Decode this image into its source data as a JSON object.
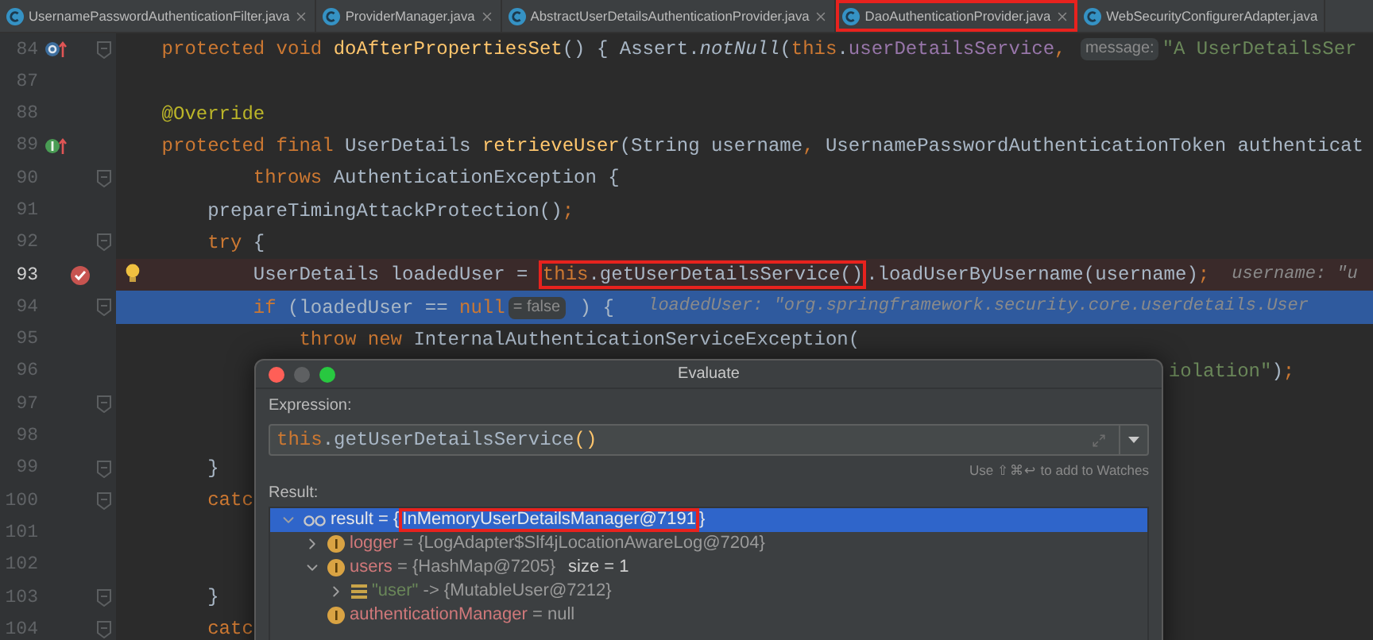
{
  "tabs": [
    {
      "label": "UsernamePasswordAuthenticationFilter.java",
      "boxed": false,
      "closable": true
    },
    {
      "label": "ProviderManager.java",
      "boxed": false,
      "closable": true
    },
    {
      "label": "AbstractUserDetailsAuthenticationProvider.java",
      "boxed": false,
      "closable": true
    },
    {
      "label": "DaoAuthenticationProvider.java",
      "boxed": true,
      "closable": true
    },
    {
      "label": "WebSecurityConfigurerAdapter.java",
      "boxed": false,
      "closable": false
    }
  ],
  "editor": {
    "lines": [
      {
        "number": "84",
        "kind": "override",
        "bulb": false,
        "fold": true,
        "selected": false,
        "segments": [
          {
            "text": "    protected void ",
            "kind": "kw"
          },
          {
            "text": "doAfterPropertiesSet",
            "kind": "method"
          },
          {
            "text": "() { Assert.",
            "kind": "plain"
          },
          {
            "text": "notNull",
            "kind": "static"
          },
          {
            "text": "(",
            "kind": "plain"
          },
          {
            "text": "this",
            "kind": "kw"
          },
          {
            "text": ".",
            "kind": "plain"
          },
          {
            "text": "userDetailsService",
            "kind": "field"
          },
          {
            "text": ", ",
            "kind": "kw"
          },
          {
            "text": "message:",
            "kind": "hint"
          },
          {
            "text": "\"A UserDetailsSer",
            "kind": "str"
          }
        ]
      },
      {
        "number": "87",
        "bulb": false,
        "fold": false,
        "selected": false
      },
      {
        "number": "88",
        "bulb": false,
        "fold": false,
        "selected": false,
        "segments": [
          {
            "text": "    @Override",
            "kind": "ann"
          }
        ]
      },
      {
        "number": "89",
        "kind": "implements",
        "bulb": false,
        "fold": false,
        "selected": false,
        "segments": [
          {
            "text": "    protected final ",
            "kind": "kw"
          },
          {
            "text": "UserDetails ",
            "kind": "plain"
          },
          {
            "text": "retrieveUser",
            "kind": "method"
          },
          {
            "text": "(String username",
            "kind": "plain"
          },
          {
            "text": ", ",
            "kind": "kw"
          },
          {
            "text": "UsernamePasswordAuthenticationToken authenticat",
            "kind": "plain"
          }
        ]
      },
      {
        "number": "90",
        "bulb": false,
        "fold": true,
        "selected": false,
        "segments": [
          {
            "text": "            throws ",
            "kind": "kw"
          },
          {
            "text": "AuthenticationException {",
            "kind": "plain"
          }
        ]
      },
      {
        "number": "91",
        "bulb": false,
        "fold": false,
        "selected": false,
        "segments": [
          {
            "text": "        prepareTimingAttackProtection()",
            "kind": "plain"
          },
          {
            "text": ";",
            "kind": "kw"
          }
        ]
      },
      {
        "number": "92",
        "bulb": false,
        "fold": true,
        "selected": false,
        "segments": [
          {
            "text": "        try ",
            "kind": "kw"
          },
          {
            "text": "{",
            "kind": "plain"
          }
        ]
      },
      {
        "number": "93",
        "kind": "breakpoint",
        "bulb": true,
        "fold": false,
        "selected": false,
        "segments": [
          {
            "text": "            UserDetails loadedUser = ",
            "kind": "plain"
          },
          {
            "text": "this",
            "kind": "kw",
            "boxed": true
          },
          {
            "text": ".getUserDetailsService()",
            "kind": "plain",
            "boxed": true
          },
          {
            "text": ".loadUserByUsername(username)",
            "kind": "plain"
          },
          {
            "text": ";",
            "kind": "kw"
          },
          {
            "text": "username: \"u",
            "kind": "debug"
          }
        ]
      },
      {
        "number": "94",
        "bulb": false,
        "fold": true,
        "selected": true,
        "segments": [
          {
            "text": "            if ",
            "kind": "kw"
          },
          {
            "text": "(loadedUser == ",
            "kind": "plain"
          },
          {
            "text": "null",
            "kind": "kw"
          },
          {
            "text": "= false",
            "kind": "hint"
          },
          {
            "text": " ) { ",
            "kind": "plain"
          },
          {
            "text": "loadedUser: \"org.springframework.security.core.userdetails.User",
            "kind": "debug"
          }
        ]
      },
      {
        "number": "95",
        "bulb": false,
        "fold": false,
        "selected": false,
        "segments": [
          {
            "text": "                throw new ",
            "kind": "kw"
          },
          {
            "text": "InternalAuthenticationServiceException(",
            "kind": "plain"
          }
        ]
      },
      {
        "number": "96",
        "bulb": false,
        "fold": false,
        "selected": false,
        "segments": [
          {
            "text": "                                                                                            iolation\"",
            "kind": "str"
          },
          {
            "text": ")",
            "kind": "plain"
          },
          {
            "text": ";",
            "kind": "kw"
          }
        ]
      },
      {
        "number": "97",
        "bulb": false,
        "fold": true,
        "selected": false
      },
      {
        "number": "98",
        "bulb": false,
        "fold": false,
        "selected": false
      },
      {
        "number": "99",
        "bulb": false,
        "fold": true,
        "selected": false,
        "segments": [
          {
            "text": "        }",
            "kind": "plain"
          }
        ]
      },
      {
        "number": "100",
        "bulb": false,
        "fold": true,
        "selected": false,
        "segments": [
          {
            "text": "        catc",
            "kind": "kw"
          }
        ]
      },
      {
        "number": "101",
        "bulb": false,
        "fold": false,
        "selected": false
      },
      {
        "number": "102",
        "bulb": false,
        "fold": false,
        "selected": false
      },
      {
        "number": "103",
        "bulb": false,
        "fold": true,
        "selected": false,
        "segments": [
          {
            "text": "        }",
            "kind": "plain"
          }
        ]
      },
      {
        "number": "104",
        "bulb": false,
        "fold": true,
        "selected": false,
        "segments": [
          {
            "text": "        catc",
            "kind": "kw"
          }
        ]
      }
    ]
  },
  "evaluate_dialog": {
    "title": "Evaluate",
    "expression_label": "Expression:",
    "expression": [
      {
        "text": "this",
        "kind": "kw"
      },
      {
        "text": ".getUserDetailsService",
        "kind": "plain"
      },
      {
        "text": "()",
        "kind": "method"
      }
    ],
    "watch_hint": "Use ⇧⌘↩ to add to Watches",
    "result_label": "Result:",
    "tree": [
      {
        "kind": "watch",
        "name": "result",
        "separator": "=",
        "value": [
          {
            "text": "{"
          },
          {
            "text": "InMemoryUserDetailsManager@7191",
            "boxed": true
          },
          {
            "text": "}"
          }
        ],
        "expanded": true,
        "selected": true,
        "children": [
          {
            "kind": "field",
            "name": "logger",
            "separator": "=",
            "value": [
              {
                "text": "{LogAdapter$Slf4jLocationAwareLog@7204}"
              }
            ],
            "expanded": false,
            "selected": false
          },
          {
            "kind": "field",
            "name": "users",
            "separator": "=",
            "value": [
              {
                "text": "{HashMap@7205}"
              }
            ],
            "extra": "size = 1",
            "expanded": true,
            "selected": false,
            "children": [
              {
                "kind": "entry",
                "name": "\"user\"",
                "separator": "->",
                "value": [
                  {
                    "text": "{MutableUser@7212}"
                  }
                ],
                "expanded": false,
                "selected": false
              }
            ]
          },
          {
            "kind": "field",
            "name": "authenticationManager",
            "separator": "=",
            "value": [
              {
                "text": "null"
              }
            ],
            "selected": false
          }
        ]
      }
    ]
  }
}
